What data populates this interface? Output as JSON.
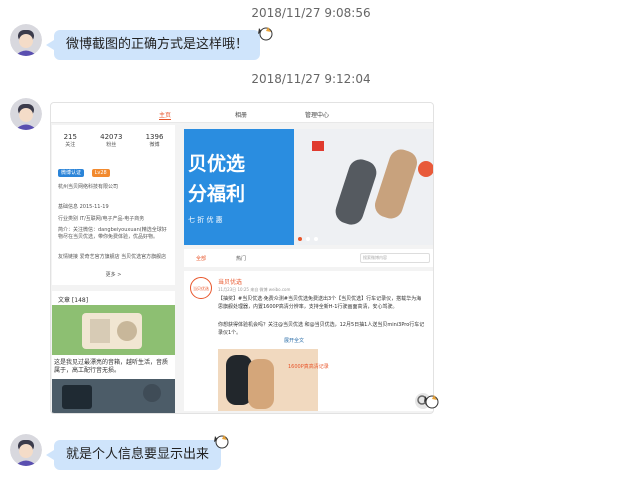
{
  "messages": [
    {
      "timestamp": "2018/11/27 9:08:56",
      "text": "微博截图的正确方式是这样哦！"
    },
    {
      "timestamp": "2018/11/27 9:12:04",
      "text": ""
    },
    {
      "timestamp": "",
      "text": "就是个人信息要显示出来"
    }
  ],
  "screenshot": {
    "nav": {
      "home": "主页",
      "album": "相册",
      "manage": "管理中心"
    },
    "stats": [
      {
        "value": "215",
        "label": "关注"
      },
      {
        "value": "42073",
        "label": "粉丝"
      },
      {
        "value": "1396",
        "label": "微博"
      }
    ],
    "badge_blue": "微博认证",
    "badge_orange": "Lv28",
    "company": "杭州当贝网络科技有限公司",
    "info": [
      "基础信息 2015-11-19",
      "行业类别 IT/互联网/电子产品-电子商务",
      "简介：关注微信：dangbeiyouxuan(精选全球好物尽在当贝优选，带你免费体验，优品好物。",
      "友情链接 爱奇艺官方旗舰店 当贝优选官方旗舰店"
    ],
    "more": "更多 >",
    "articles_title": "文章 [148]",
    "article_text": "这是我见过最漂亮的音箱，越听生活，音质属于，高工配行音无损。",
    "banner_text1": "贝优选",
    "banner_text2": "分福利",
    "banner_sub": "七 折 优 惠",
    "tabs": {
      "all": "全部",
      "hot": "热门"
    },
    "search_placeholder": "搜索微博内容",
    "post": {
      "user": "当贝优选",
      "time": "11月23日 10:25 来自 微博 weibo.com",
      "text1": "【抽奖】#当贝优选·免费众测#当贝优选免费送出3个【当贝优选】行车记录仪，搭载华为海思旗舰处理器，内置1600P高清分辨率，支持全新H-1行驶画面高清，安心驾驶。",
      "text2": "你想获得体验机会吗？关注@当贝优选 和@当贝优选，12月5日抽1人送当贝mini3Pro行车记录仪1个。",
      "expand": "展开全文",
      "card": "1600P真高清记录"
    },
    "avatar_top": "当贝优选"
  }
}
